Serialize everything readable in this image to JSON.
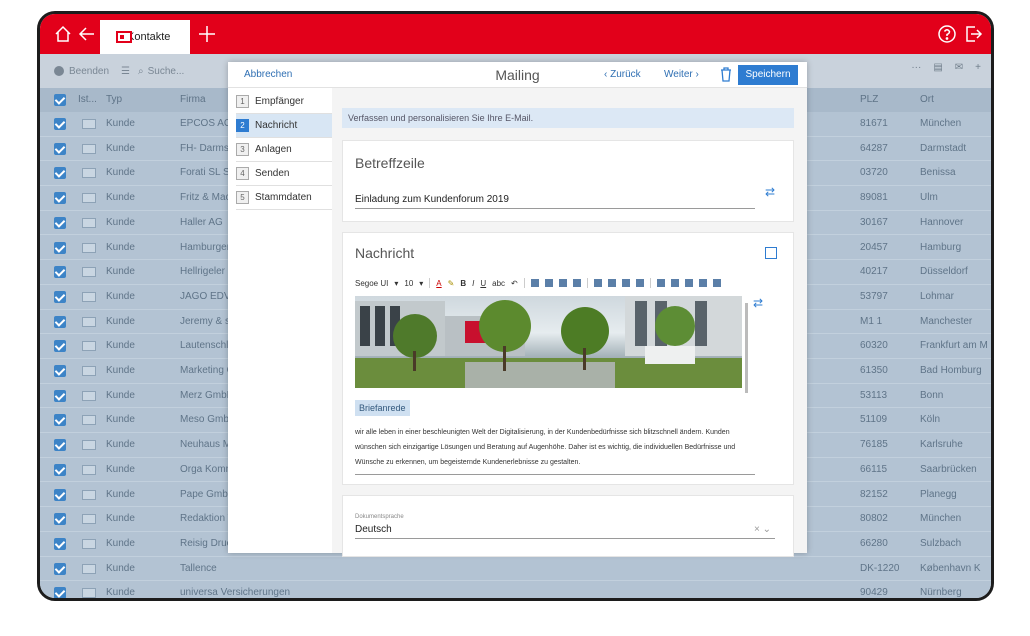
{
  "app": {
    "tab_label": "Kontakte"
  },
  "toolbar": {
    "quit_label": "Beenden",
    "search_placeholder": "Suche..."
  },
  "list": {
    "columns": [
      "Ist...",
      "Typ",
      "Firma",
      "PLZ",
      "Ort"
    ],
    "rows": [
      {
        "typ": "Kunde",
        "firma": "EPCOS AG",
        "plz": "81671",
        "ort": "München"
      },
      {
        "typ": "Kunde",
        "firma": "FH- Darmstadt",
        "plz": "64287",
        "ort": "Darmstadt"
      },
      {
        "typ": "Kunde",
        "firma": "Forati SL Spain",
        "plz": "03720",
        "ort": "Benissa"
      },
      {
        "typ": "Kunde",
        "firma": "Fritz & Macziol",
        "plz": "89081",
        "ort": "Ulm"
      },
      {
        "typ": "Kunde",
        "firma": "Haller AG",
        "plz": "30167",
        "ort": "Hannover"
      },
      {
        "typ": "Kunde",
        "firma": "Hamburger",
        "plz": "20457",
        "ort": "Hamburg"
      },
      {
        "typ": "Kunde",
        "firma": "Hellrigeler B",
        "plz": "40217",
        "ort": "Düsseldorf"
      },
      {
        "typ": "Kunde",
        "firma": "JAGO EDV- S",
        "plz": "53797",
        "ort": "Lohmar"
      },
      {
        "typ": "Kunde",
        "firma": "Jeremy & so",
        "plz": "M1 1",
        "ort": "Manchester"
      },
      {
        "typ": "Kunde",
        "firma": "Lautenschläg",
        "plz": "60320",
        "ort": "Frankfurt am M"
      },
      {
        "typ": "Kunde",
        "firma": "Marketing C",
        "plz": "61350",
        "ort": "Bad Homburg"
      },
      {
        "typ": "Kunde",
        "firma": "Merz GmbH",
        "plz": "53113",
        "ort": "Bonn"
      },
      {
        "typ": "Kunde",
        "firma": "Meso GmbH",
        "plz": "51109",
        "ort": "Köln"
      },
      {
        "typ": "Kunde",
        "firma": "Neuhaus Me",
        "plz": "76185",
        "ort": "Karlsruhe"
      },
      {
        "typ": "Kunde",
        "firma": "Orga Komm",
        "plz": "66115",
        "ort": "Saarbrücken"
      },
      {
        "typ": "Kunde",
        "firma": "Pape GmbH",
        "plz": "82152",
        "ort": "Planegg"
      },
      {
        "typ": "Kunde",
        "firma": "Redaktion W",
        "plz": "80802",
        "ort": "München"
      },
      {
        "typ": "Kunde",
        "firma": "Reisig Druck",
        "plz": "66280",
        "ort": "Sulzbach"
      },
      {
        "typ": "Kunde",
        "firma": "Tallence",
        "plz": "DK-1220",
        "ort": "København K"
      },
      {
        "typ": "Kunde",
        "firma": "universa Versicherungen",
        "plz": "90429",
        "ort": "Nürnberg"
      }
    ]
  },
  "dialog": {
    "cancel_label": "Abbrechen",
    "title": "Mailing",
    "back_label": "Zurück",
    "next_label": "Weiter",
    "save_label": "Speichern",
    "steps": [
      {
        "num": "1",
        "label": "Empfänger"
      },
      {
        "num": "2",
        "label": "Nachricht"
      },
      {
        "num": "3",
        "label": "Anlagen"
      },
      {
        "num": "4",
        "label": "Senden"
      },
      {
        "num": "5",
        "label": "Stammdaten"
      }
    ],
    "hint": "Verfassen und personalisieren Sie Ihre E-Mail.",
    "subject": {
      "heading": "Betreffzeile",
      "value": "Einladung zum Kundenforum 2019"
    },
    "message": {
      "heading": "Nachricht",
      "font": "Segoe UI",
      "size": "10",
      "placeholder_tag": "Briefanrede",
      "body": "wir alle leben in einer beschleunigten Welt der Digitalisierung, in der Kundenbedürfnisse sich blitzschnell ändern. Kunden wünschen sich einzigartige Lösungen und Beratung auf Augenhöhe. Daher ist es wichtig, die individuellen Bedürfnisse und Wünsche zu erkennen, um begeisternde Kundenerlebnisse zu gestalten."
    },
    "language": {
      "label": "Dokumentsprache",
      "value": "Deutsch"
    }
  }
}
